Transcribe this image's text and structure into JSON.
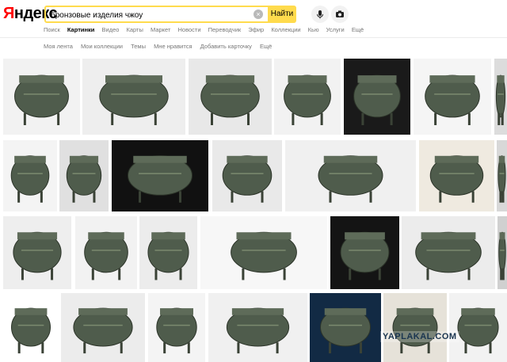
{
  "logo": {
    "first_letter": "Я",
    "rest": "ндекс"
  },
  "search": {
    "query": "бронзовые изделия чжоу",
    "button_label": "Найти"
  },
  "tabs": [
    {
      "label": "Поиск",
      "active": false
    },
    {
      "label": "Картинки",
      "active": true
    },
    {
      "label": "Видео",
      "active": false
    },
    {
      "label": "Карты",
      "active": false
    },
    {
      "label": "Маркет",
      "active": false
    },
    {
      "label": "Новости",
      "active": false
    },
    {
      "label": "Переводчик",
      "active": false
    },
    {
      "label": "Эфир",
      "active": false
    },
    {
      "label": "Коллекции",
      "active": false
    },
    {
      "label": "Кью",
      "active": false
    },
    {
      "label": "Услуги",
      "active": false
    },
    {
      "label": "Ещё",
      "active": false
    }
  ],
  "subnav": [
    "Моя лента",
    "Мои коллекции",
    "Темы",
    "Мне нравится",
    "Добавить карточку",
    "Ещё"
  ],
  "watermark": "YAPLAKAL.COM",
  "colors": {
    "accent": "#ffdb4d",
    "logo_red": "#ff0000",
    "tab_text": "#777777"
  }
}
